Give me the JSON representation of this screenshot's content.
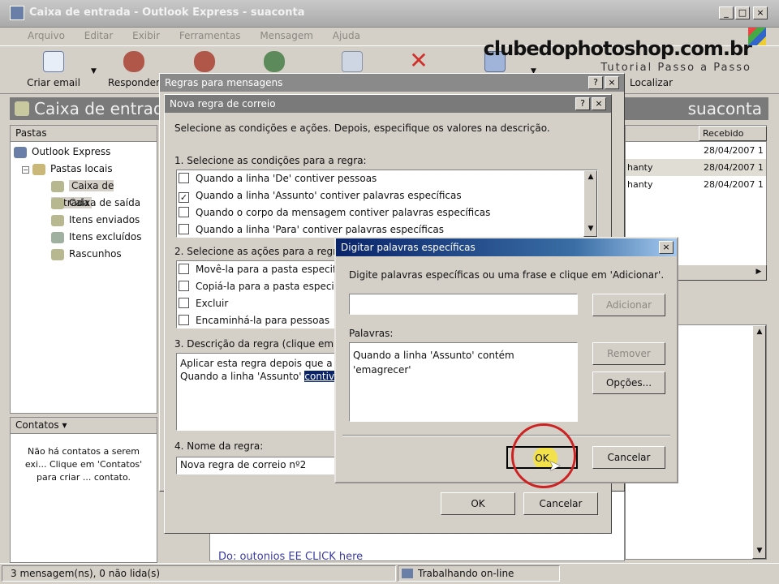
{
  "window": {
    "title": "Caixa de entrada - Outlook Express - suaconta",
    "controls": [
      "_",
      "□",
      "×"
    ]
  },
  "menu": [
    "Arquivo",
    "Editar",
    "Exibir",
    "Ferramentas",
    "Mensagem",
    "Ajuda"
  ],
  "toolbar": {
    "new_mail": "Criar email",
    "reply": "Responder",
    "find": "Localizar"
  },
  "watermark": {
    "site": "clubedophotoshop.com.br",
    "tagline": "Tutorial Passo a Passo"
  },
  "header": {
    "folder": "Caixa de entrada",
    "account": "suaconta"
  },
  "folders": {
    "header": "Pastas",
    "items": [
      "Outlook Express",
      "Pastas locais",
      "Caixa de entrada",
      "Caixa de saída",
      "Itens enviados",
      "Itens excluídos",
      "Rascunhos"
    ]
  },
  "contacts": {
    "header": "Contatos ▾",
    "message": "Não há contatos a serem exi... Clique em 'Contatos' para criar ... contato."
  },
  "message_list": {
    "column_received": "Recebido",
    "rows": [
      {
        "from": "",
        "date": "28/04/2007 1"
      },
      {
        "from": "hanty",
        "date": "28/04/2007 1"
      },
      {
        "from": "hanty",
        "date": "28/04/2007 1"
      }
    ]
  },
  "preview_partial": "Do: outonios EE CLICK here",
  "status": {
    "messages": "3 mensagem(ns), 0 não lida(s)",
    "online": "Trabalhando on-line"
  },
  "rules_dialog": {
    "title": "Regras para mensagens"
  },
  "new_rule_dialog": {
    "title": "Nova regra de correio",
    "instructions": "Selecione as condições e ações. Depois, especifique os valores na descrição.",
    "step1": "1. Selecione as condições para a regra:",
    "conditions": [
      {
        "label": "Quando a linha 'De' contiver pessoas",
        "checked": false
      },
      {
        "label": "Quando a linha 'Assunto' contiver palavras específicas",
        "checked": true
      },
      {
        "label": "Quando o corpo da mensagem contiver palavras específicas",
        "checked": false
      },
      {
        "label": "Quando a linha 'Para' contiver palavras específicas",
        "checked": false
      }
    ],
    "step2": "2. Selecione as ações para a regra:",
    "actions": [
      {
        "label": "Movê-la para a pasta especificada",
        "checked": false
      },
      {
        "label": "Copiá-la para a pasta especificada",
        "checked": false
      },
      {
        "label": "Excluir",
        "checked": false
      },
      {
        "label": "Encaminhá-la para pessoas",
        "checked": false
      }
    ],
    "step3": "3. Descrição da regra (clique em um valor sublinhado para editá-lo):",
    "description_line1": "Aplicar esta regra depois que a m",
    "description_line2_prefix": "Quando a linha 'Assunto' ",
    "description_line2_link": "contiver",
    "step4": "4. Nome da regra:",
    "rule_name": "Nova regra de correio nº2",
    "ok": "OK",
    "cancel": "Cancelar"
  },
  "words_dialog": {
    "title": "Digitar palavras específicas",
    "instructions": "Digite palavras específicas ou uma frase e clique em 'Adicionar'.",
    "input_value": "",
    "add": "Adicionar",
    "words_label": "Palavras:",
    "words_line1": "Quando a linha 'Assunto' contém",
    "words_line2": "'emagrecer'",
    "remove": "Remover",
    "options": "Opções...",
    "ok": "OK",
    "cancel": "Cancelar"
  },
  "colors": {
    "active_title": "#0a246a",
    "inactive_title": "#808080",
    "highlight_circle": "#cc2222",
    "click_glow": "#f2e14a"
  }
}
